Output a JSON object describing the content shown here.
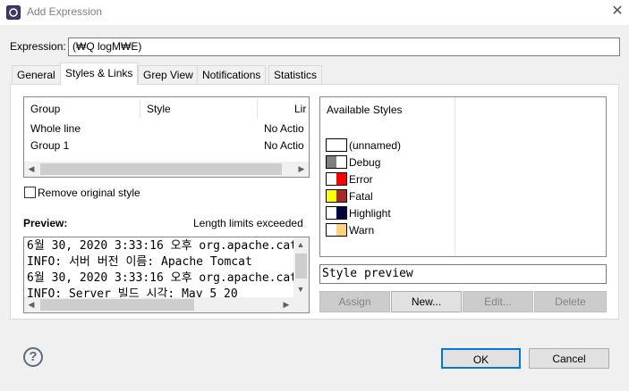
{
  "window": {
    "title": "Add Expression",
    "close_glyph": "✕",
    "icon": "app-icon"
  },
  "expression": {
    "label": "Expression:",
    "value": "(₩Q logM₩E)"
  },
  "tabs": [
    {
      "label": "General",
      "active": false
    },
    {
      "label": "Styles & Links",
      "active": true
    },
    {
      "label": "Grep View",
      "active": false
    },
    {
      "label": "Notifications",
      "active": false
    },
    {
      "label": "Statistics",
      "active": false
    }
  ],
  "group_table": {
    "columns": [
      "Group",
      "Style",
      "Lir"
    ],
    "rows": [
      {
        "group": "Whole line",
        "style": "",
        "link": "No Actio"
      },
      {
        "group": "Group 1",
        "style": "",
        "link": "No Actio"
      }
    ]
  },
  "remove_style": {
    "label": "Remove original style",
    "checked": false
  },
  "preview": {
    "label": "Preview:",
    "status": "Length limits exceeded",
    "lines": [
      "6월 30, 2020 3:33:16 오후 org.apache.cata",
      "INFO: 서버 버전 이름:          Apache Tomcat",
      "6월 30, 2020 3:33:16 오후 org.apache.cata",
      "INFO: Server 빌드 시각:          May 5 20"
    ]
  },
  "available_styles": {
    "header": "Available Styles",
    "items": [
      {
        "label": "(unnamed)",
        "fg": "#ffffff",
        "bg": "#ffffff"
      },
      {
        "label": "Debug",
        "fg": "#808080",
        "bg": "#ffffff"
      },
      {
        "label": "Error",
        "fg": "#ffffff",
        "bg": "#ff0000"
      },
      {
        "label": "Fatal",
        "fg": "#ffff00",
        "bg": "#a52a2a"
      },
      {
        "label": "Highlight",
        "fg": "#ffffff",
        "bg": "#000040"
      },
      {
        "label": "Warn",
        "fg": "#ffffff",
        "bg": "#ffd080"
      }
    ]
  },
  "style_preview": {
    "text": "Style preview"
  },
  "style_buttons": {
    "assign": "Assign",
    "new": "New...",
    "edit": "Edit...",
    "delete": "Delete"
  },
  "footer": {
    "help_glyph": "?",
    "ok": "OK",
    "cancel": "Cancel"
  }
}
